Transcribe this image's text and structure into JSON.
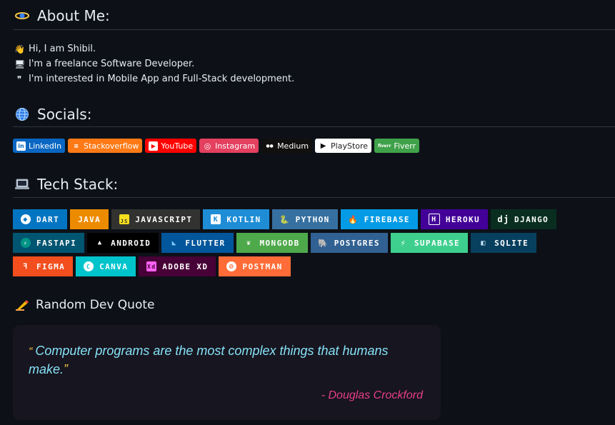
{
  "about": {
    "title": "About Me:",
    "lines": [
      {
        "icon": "👋",
        "text": "Hi, I am Shibil."
      },
      {
        "icon": "🖥",
        "text": "I'm a freelance Software Developer."
      },
      {
        "icon": "❞",
        "text": "I'm interested in Mobile App and Full-Stack development."
      }
    ]
  },
  "socials": {
    "title": "Socials:",
    "badges": [
      {
        "label": "LinkedIn",
        "icon": "in",
        "bg": "#0a66c2"
      },
      {
        "label": "Stackoverflow",
        "icon": "≡",
        "bg": "#fe7a16"
      },
      {
        "label": "YouTube",
        "icon": "▶",
        "bg": "#ff0000"
      },
      {
        "label": "Instagram",
        "icon": "◎",
        "bg": "#e4405f"
      },
      {
        "label": "Medium",
        "icon": "●●",
        "bg": "#12100e"
      },
      {
        "label": "PlayStore",
        "icon": "▶",
        "bg": "#ffffff"
      },
      {
        "label": "Fiverr",
        "icon": "fiverr",
        "bg": "#1dbf73"
      }
    ]
  },
  "tech": {
    "title": "Tech Stack:",
    "rows": [
      [
        {
          "label": "DART",
          "icon": "◆",
          "bg": "#0175c2"
        },
        {
          "label": "JAVA",
          "icon": "☕",
          "bg": "#ed8b00"
        },
        {
          "label": "JAVASCRIPT",
          "icon": "JS",
          "bg": "#323330"
        },
        {
          "label": "KOTLIN",
          "icon": "K",
          "bg": "#7f52ff"
        },
        {
          "label": "PYTHON",
          "icon": "🐍",
          "bg": "#3670a0"
        },
        {
          "label": "FIREBASE",
          "icon": "🔥",
          "bg": "#039be5"
        },
        {
          "label": "HEROKU",
          "icon": "H",
          "bg": "#430098"
        },
        {
          "label": "DJANGO",
          "icon": "dj",
          "bg": "#092e20"
        }
      ],
      [
        {
          "label": "FASTAPI",
          "icon": "⚡",
          "bg": "#005571"
        },
        {
          "label": "ANDROID",
          "icon": "▲",
          "bg": "#000000"
        },
        {
          "label": "FLUTTER",
          "icon": "◣",
          "bg": "#02569b"
        },
        {
          "label": "MONGODB",
          "icon": "❦",
          "bg": "#4ea94b"
        },
        {
          "label": "POSTGRES",
          "icon": "🐘",
          "bg": "#316192"
        },
        {
          "label": "SUPABASE",
          "icon": "⚡",
          "bg": "#3ecf8e"
        },
        {
          "label": "SQLITE",
          "icon": "◧",
          "bg": "#07405e"
        }
      ],
      [
        {
          "label": "FIGMA",
          "icon": "ꟻ",
          "bg": "#f24e1e"
        },
        {
          "label": "CANVA",
          "icon": "C",
          "bg": "#00c4cc"
        },
        {
          "label": "ADOBE XD",
          "icon": "Xd",
          "bg": "#470137"
        },
        {
          "label": "POSTMAN",
          "icon": "⊘",
          "bg": "#ff6c37"
        }
      ]
    ]
  },
  "quote": {
    "title": "Random Dev Quote",
    "text": "Computer programs are the most complex things that humans make.",
    "author": "- Douglas Crockford"
  }
}
